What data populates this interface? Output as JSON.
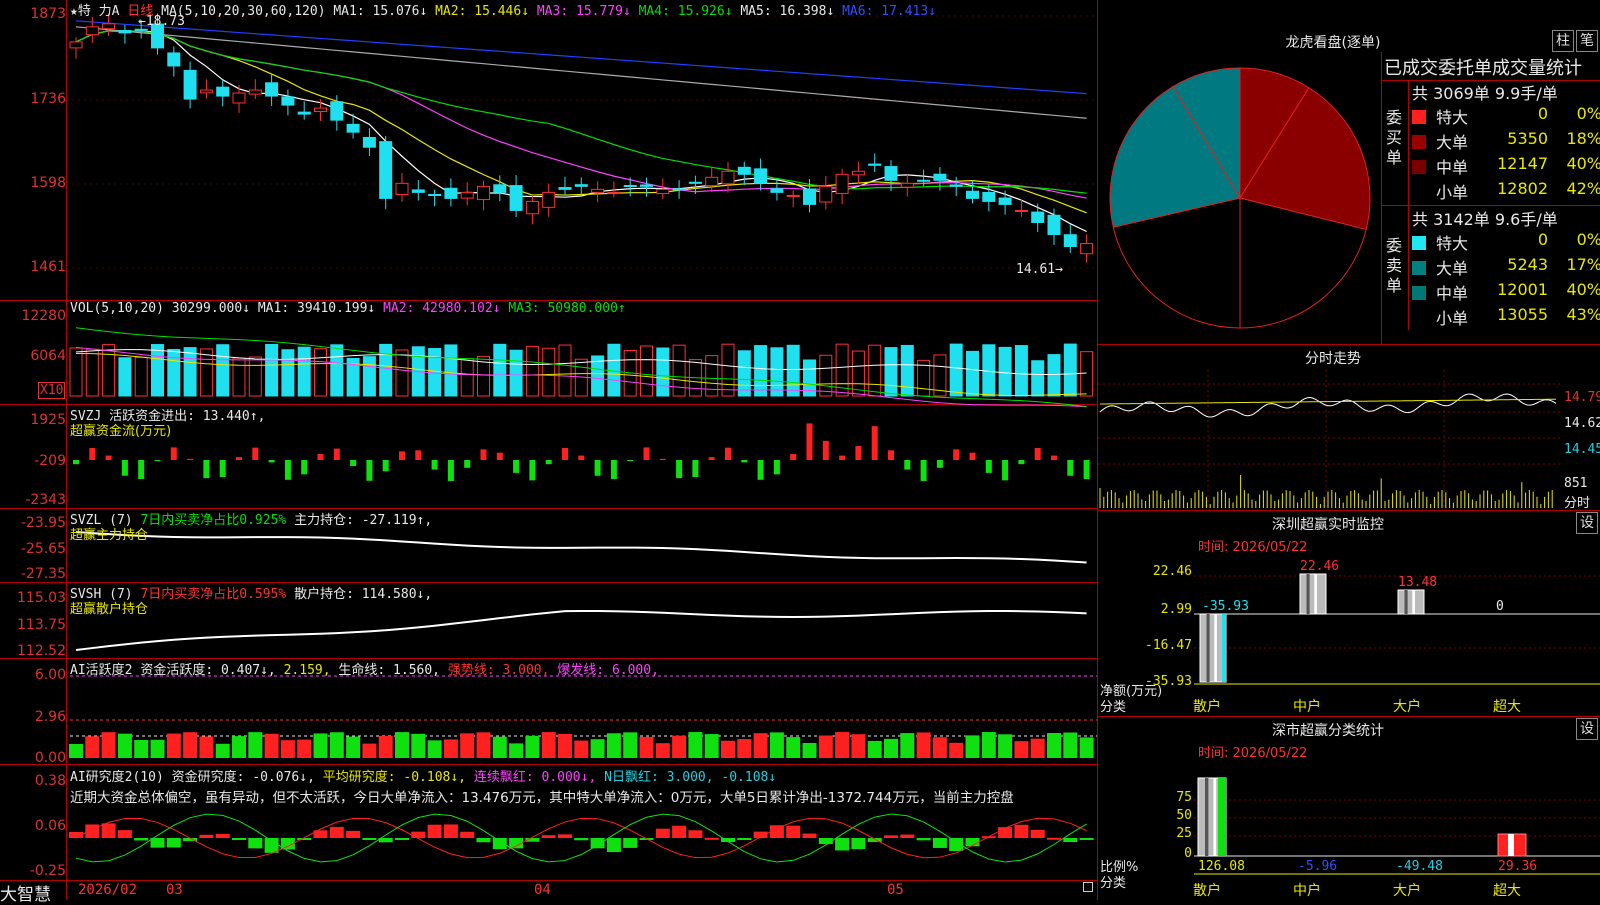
{
  "app": {
    "brand": "大智慧"
  },
  "kline": {
    "header_name": "★特 力A",
    "header_period": "日线",
    "ma_label": "MA(5,10,20,30,60,120)",
    "ma1": "MA1: 15.076↓",
    "ma2": "MA2: 15.446↓",
    "ma3": "MA3: 15.779↓",
    "ma4": "MA4: 15.926↓",
    "ma5": "MA5: 16.398↓",
    "ma6": "MA6: 17.413↓",
    "high_label": "18.73",
    "low_label": "14.61",
    "y_ticks": [
      "1873",
      "1736",
      "1598",
      "1461"
    ]
  },
  "vol": {
    "label": "VOL(5,10,20)",
    "value": "30299.000↓",
    "ma1": "MA1: 39410.199↓",
    "ma2": "MA2: 42980.102↓",
    "ma3": "MA3: 50980.000↑",
    "y_ticks": [
      "12280",
      "6064"
    ],
    "unit": "X10"
  },
  "svzj": {
    "label": "SVZJ",
    "desc": "活跃资金进出: 13.440↑,",
    "sub": "超赢资金流(万元)",
    "y_ticks": [
      "1925",
      "-209",
      "-2343"
    ]
  },
  "svzl": {
    "label": "SVZL (7)",
    "pct": "7日内买卖净占比0.925%",
    "hold": "主力持仓: -27.119↑,",
    "sub": "超赢主力持仓",
    "y_ticks": [
      "-23.95",
      "-25.65",
      "-27.35"
    ]
  },
  "svsh": {
    "label": "SVSH (7)",
    "pct": "7日内买卖净占比0.595%",
    "hold": "散户持仓: 114.580↓,",
    "sub": "超赢散户持仓",
    "y_ticks": [
      "115.03",
      "113.75",
      "112.52"
    ]
  },
  "ai1": {
    "label": "AI活跃度2",
    "act": "资金活跃度: 0.407↓,",
    "v2": "2.159,",
    "life": "生命线: 1.560,",
    "strong": "强势线: 3.000,",
    "burst": "爆发线: 6.000,",
    "y_ticks": [
      "6.00",
      "2.96",
      "0.00"
    ]
  },
  "ai2": {
    "label": "AI研究度2(10)",
    "res": "资金研究度: -0.076↓,",
    "avg": "平均研究度: -0.108↓,",
    "lianxu": "连续飘红: 0.000↓,",
    "nday": "N日飘红: 3.000, -0.108↓",
    "comment": "近期大资金总体偏空，虽有异动，但不太活跃，今日大单净流入：13.476万元，其中特大单净流入：0万元，大单5日累计净出-1372.744万元，当前主力控盘",
    "y_ticks": [
      "0.38",
      "0.06",
      "-0.25"
    ]
  },
  "xaxis": {
    "labels": [
      "2026/02",
      "03",
      "04",
      "05"
    ]
  },
  "lhb": {
    "title": "龙虎看盘(逐单)",
    "btn1": "柱",
    "btn2": "笔",
    "stat_title": "已成交委托单成交量统计",
    "buy": {
      "label": "委买单",
      "total": "共 3069单 9.9手/单",
      "rows": [
        {
          "name": "特大",
          "value": "0",
          "pct": "0%",
          "color": "#ff2020"
        },
        {
          "name": "大单",
          "value": "5350",
          "pct": "18%",
          "color": "#9a0000"
        },
        {
          "name": "中单",
          "value": "12147",
          "pct": "40%",
          "color": "#7a0000"
        },
        {
          "name": "小单",
          "value": "12802",
          "pct": "42%",
          "color": "#000000"
        }
      ]
    },
    "sell": {
      "label": "委卖单",
      "total": "共 3142单 9.6手/单",
      "rows": [
        {
          "name": "特大",
          "value": "0",
          "pct": "0%",
          "color": "#20e8f0"
        },
        {
          "name": "大单",
          "value": "5243",
          "pct": "17%",
          "color": "#008080"
        },
        {
          "name": "中单",
          "value": "12001",
          "pct": "40%",
          "color": "#007878"
        },
        {
          "name": "小单",
          "value": "13055",
          "pct": "43%",
          "color": "#000000"
        }
      ]
    }
  },
  "intraday": {
    "title": "分时走势",
    "y_ticks": [
      "14.79",
      "14.62",
      "14.45"
    ],
    "vol_tick": "851",
    "vol_unit": "分时"
  },
  "monitor": {
    "title": "深圳超赢实时监控",
    "btn": "设",
    "date": "时间: 2026/05/22",
    "y_ticks": [
      "22.46",
      "2.99",
      "-16.47",
      "-35.93"
    ],
    "cats": [
      "散户",
      "中户",
      "大户",
      "超大"
    ],
    "vals": [
      "-35.93",
      "22.46",
      "13.48",
      "0"
    ],
    "ylabel": "净额(万元)",
    "xlabel": "分类"
  },
  "classify": {
    "title": "深市超赢分类统计",
    "btn": "设",
    "date": "时间: 2026/05/22",
    "y_ticks": [
      "75",
      "50",
      "25",
      "0"
    ],
    "cats": [
      "散户",
      "中户",
      "大户",
      "超大"
    ],
    "vals": [
      "126.08",
      "-5.96",
      "-49.48",
      "29.36"
    ],
    "ylabel": "比例%",
    "xlabel": "分类"
  },
  "chart_data": [
    {
      "type": "candlestick",
      "title": "★特 力A 日线",
      "ylim": [
        14.5,
        18.8
      ],
      "y_ticks": [
        18.73,
        17.36,
        15.98,
        14.61
      ],
      "high": 18.73,
      "low": 14.61,
      "close": [
        18.3,
        18.55,
        18.6,
        18.45,
        18.5,
        18.2,
        17.9,
        17.35,
        17.5,
        17.4,
        17.45,
        17.5,
        17.4,
        17.25,
        17.1,
        17.2,
        17.0,
        16.8,
        16.55,
        15.7,
        15.95,
        15.8,
        15.75,
        15.7,
        15.8,
        15.9,
        15.8,
        15.5,
        15.65,
        15.8,
        15.85,
        15.9,
        15.85,
        15.8,
        15.9,
        15.9,
        15.85,
        15.85,
        15.95,
        16.05,
        16.15,
        16.1,
        15.95,
        15.8,
        15.75,
        15.6,
        15.9,
        16.1,
        16.15,
        16.25,
        16.0,
        15.95,
        16.0,
        16.0,
        15.9,
        15.7,
        15.65,
        15.6,
        15.5,
        15.3,
        15.1,
        14.9,
        14.95
      ]
    },
    {
      "type": "bar",
      "title": "VOL(5,10,20)",
      "ylim": [
        0,
        12280
      ]
    },
    {
      "type": "bar",
      "title": "超赢资金流(万元)",
      "ylim": [
        -2343,
        1925
      ]
    },
    {
      "type": "line",
      "title": "超赢主力持仓",
      "ylim": [
        -27.35,
        -23.95
      ]
    },
    {
      "type": "line",
      "title": "超赢散户持仓",
      "ylim": [
        112.52,
        115.03
      ]
    },
    {
      "type": "bar",
      "title": "AI活跃度2",
      "ylim": [
        0,
        6.0
      ]
    },
    {
      "type": "bar",
      "title": "AI研究度2(10)",
      "ylim": [
        -0.25,
        0.38
      ]
    },
    {
      "type": "pie",
      "title": "龙虎看盘(逐单)",
      "slices": [
        {
          "name": "委买 大单",
          "value": 18
        },
        {
          "name": "委买 中单",
          "value": 40
        },
        {
          "name": "委买 小单",
          "value": 42
        },
        {
          "name": "委卖 大单",
          "value": 17
        },
        {
          "name": "委卖 中单",
          "value": 40
        },
        {
          "name": "委卖 小单",
          "value": 43
        }
      ]
    },
    {
      "type": "bar",
      "title": "深圳超赢实时监控",
      "categories": [
        "散户",
        "中户",
        "大户",
        "超大"
      ],
      "values": [
        -35.93,
        22.46,
        13.48,
        0
      ],
      "ylim": [
        -35.93,
        22.46
      ]
    },
    {
      "type": "bar",
      "title": "深市超赢分类统计",
      "categories": [
        "散户",
        "中户",
        "大户",
        "超大"
      ],
      "values": [
        126.08,
        -5.96,
        -49.48,
        29.36
      ],
      "ylim": [
        0,
        75
      ]
    }
  ]
}
